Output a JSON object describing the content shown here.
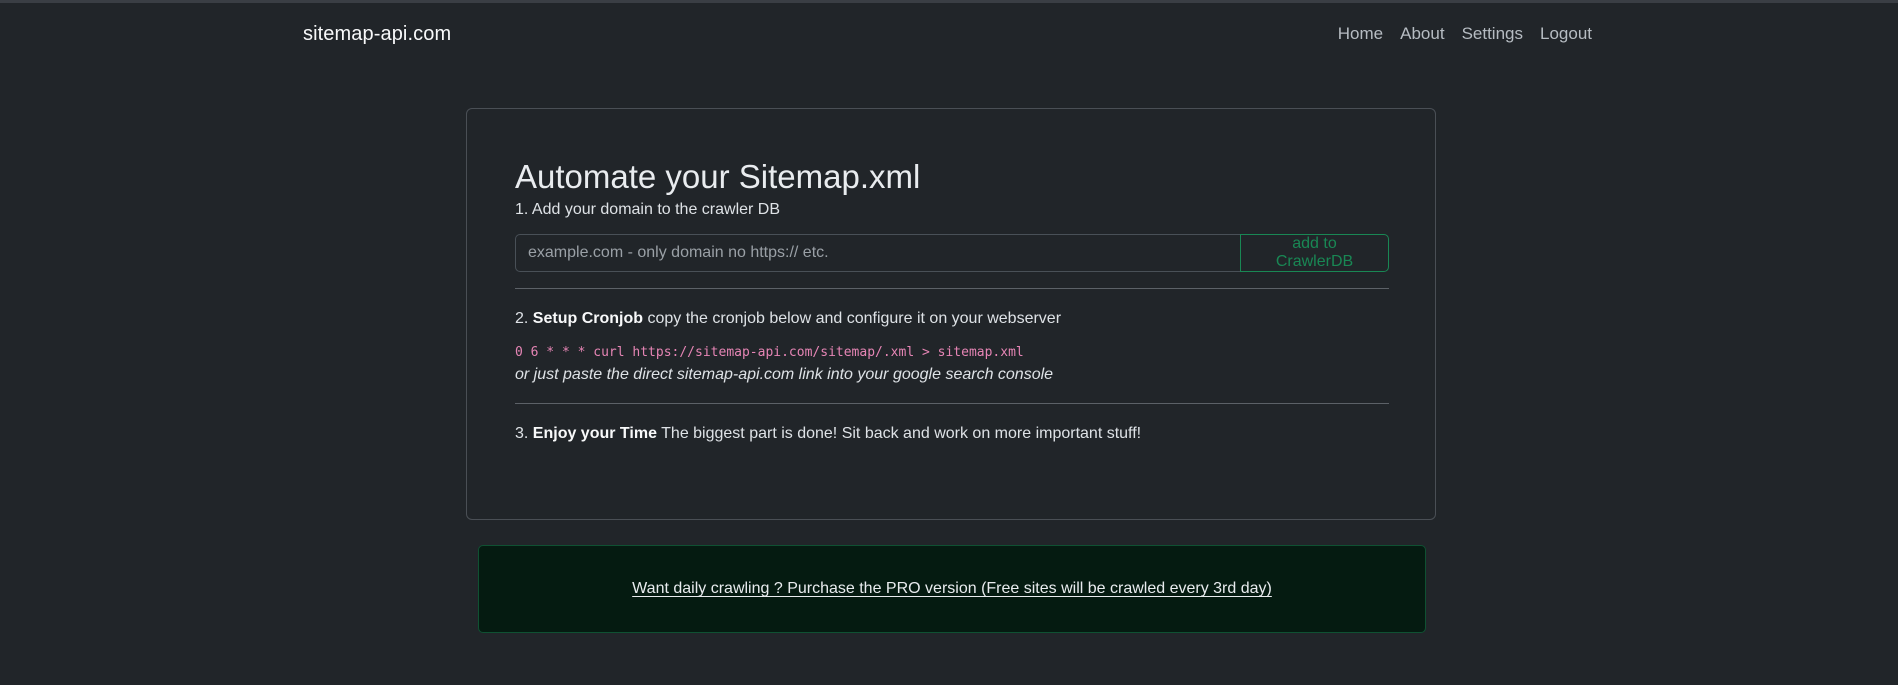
{
  "navbar": {
    "brand": "sitemap-api.com",
    "links": [
      "Home",
      "About",
      "Settings",
      "Logout"
    ]
  },
  "card": {
    "title": "Automate your Sitemap.xml",
    "step1": "1. Add your domain to the crawler DB",
    "domain_input": {
      "value": "",
      "placeholder": "example.com - only domain no https:// etc."
    },
    "add_button": "add to CrawlerDB",
    "step2": {
      "prefix": "2. ",
      "bold": "Setup Cronjob",
      "text": " copy the cronjob below and configure it on your webserver"
    },
    "cronjob": "0 6 * * * curl https://sitemap-api.com/sitemap/.xml > sitemap.xml",
    "hint": "or just paste the direct sitemap-api.com link into your google search console",
    "step3": {
      "prefix": "3. ",
      "bold": "Enjoy your Time",
      "text": " The biggest part is done! Sit back and work on more important stuff!"
    }
  },
  "promo": {
    "link": "Want daily crawling ? Purchase the PRO version (Free sites will be crawled every 3rd day)"
  },
  "colors": {
    "background": "#212529",
    "success": "#198754",
    "code": "#e685b5",
    "promo_background": "#051b11"
  }
}
